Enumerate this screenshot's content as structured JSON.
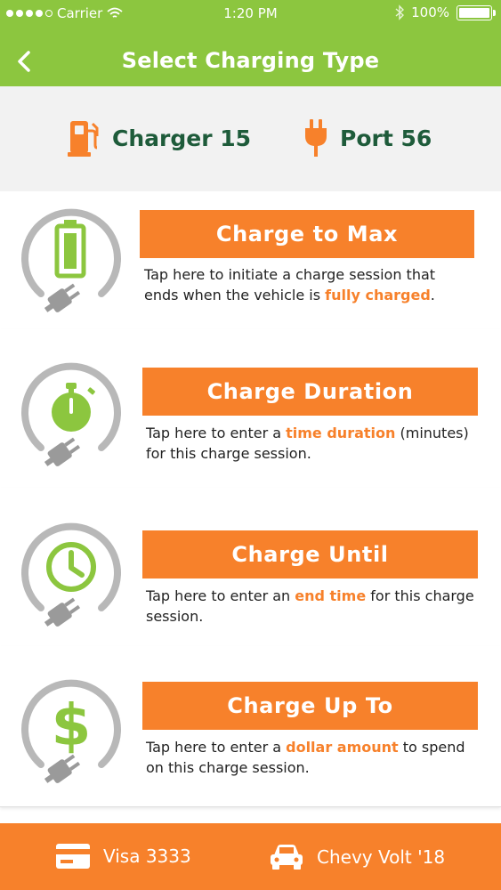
{
  "status_bar": {
    "carrier": "Carrier",
    "time": "1:20 PM",
    "battery": "100%"
  },
  "header": {
    "title": "Select Charging Type",
    "back_icon": "chevron-left-icon"
  },
  "info": {
    "charger": "Charger 15",
    "port": "Port 56"
  },
  "options": [
    {
      "title": "Charge to Max",
      "desc_before": "Tap here to initiate a charge session that ends when the vehicle is ",
      "desc_highlight": "fully charged",
      "desc_after": ".",
      "icon": "battery-icon"
    },
    {
      "title": "Charge Duration",
      "desc_before": "Tap here to enter a ",
      "desc_highlight": "time duration",
      "desc_after": " (minutes) for this charge session.",
      "icon": "stopwatch-icon"
    },
    {
      "title": "Charge Until",
      "desc_before": "Tap here to enter an ",
      "desc_highlight": "end time",
      "desc_after": " for this charge session.",
      "icon": "clock-icon"
    },
    {
      "title": "Charge Up To",
      "desc_before": "Tap here to enter a ",
      "desc_highlight": "dollar amount",
      "desc_after": " to spend on this charge session.",
      "icon": "dollar-icon"
    }
  ],
  "bottom_bar": {
    "payment": "Visa 3333",
    "vehicle": "Chevy Volt '18"
  },
  "colors": {
    "header_green": "#8cc63f",
    "accent_orange": "#f7812b",
    "text_dark_green": "#1e5b3a",
    "ring_gray": "#b8b8b8"
  }
}
